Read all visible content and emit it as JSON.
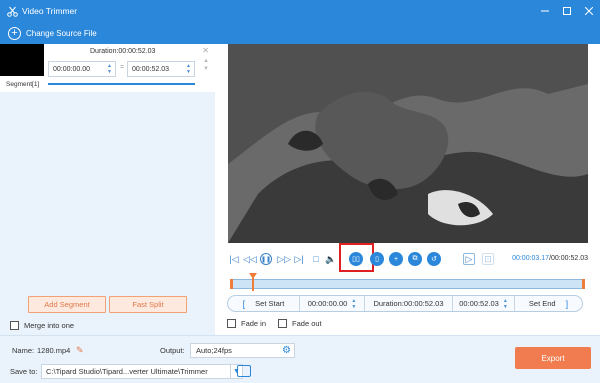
{
  "window": {
    "title": "Video Trimmer"
  },
  "toolbar": {
    "change_source": "Change Source File"
  },
  "segment": {
    "duration": "Duration:00:00:52.03",
    "start": "00:00:00.00",
    "end": "00:00:52.03",
    "label": "Segment[1]"
  },
  "left": {
    "add_segment": "Add Segment",
    "fast_split": "Fast Split",
    "merge": "Merge into one"
  },
  "player": {
    "current_time": "00:00:03.17",
    "total_time": "/00:00:52.03",
    "playhead_fraction": 0.061
  },
  "trim": {
    "set_start": "Set Start",
    "start_value": "00:00:00.00",
    "duration": "Duration:00:00:52.03",
    "end_value": "00:00:52.03",
    "set_end": "Set End"
  },
  "fades": {
    "fade_in": "Fade in",
    "fade_out": "Fade out"
  },
  "bottom": {
    "name_label": "Name:",
    "name_value": "1280.mp4",
    "output_label": "Output:",
    "output_value": "Auto;24fps",
    "save_label": "Save to:",
    "save_path": "C:\\Tipard Studio\\Tipard...verter Ultimate\\Trimmer",
    "export": "Export"
  },
  "colors": {
    "accent": "#2b87d9",
    "orange": "#f07c50",
    "highlight": "#e02020"
  }
}
